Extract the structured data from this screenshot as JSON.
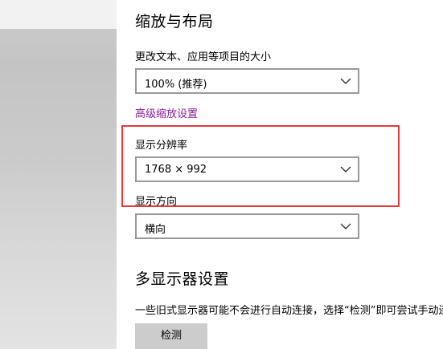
{
  "scale_layout": {
    "title": "缩放与布局",
    "scale_label": "更改文本、应用等项目的大小",
    "scale_value": "100% (推荐)",
    "advanced_link": "高级缩放设置",
    "resolution_label": "显示分辨率",
    "resolution_value": "1768 × 992",
    "orientation_label": "显示方向",
    "orientation_value": "横向"
  },
  "multi_display": {
    "title": "多显示器设置",
    "description": "一些旧式显示器可能不会进行自动连接，选择“检测”即可尝试手动连接。",
    "detect_button": "检测"
  },
  "icons": {
    "dropdown": "chevron-down-icon"
  },
  "colors": {
    "link": "#8a1c9e",
    "highlight_border": "#e43b3b",
    "dropdown_border": "#999999",
    "button_bg": "#cccccc"
  }
}
